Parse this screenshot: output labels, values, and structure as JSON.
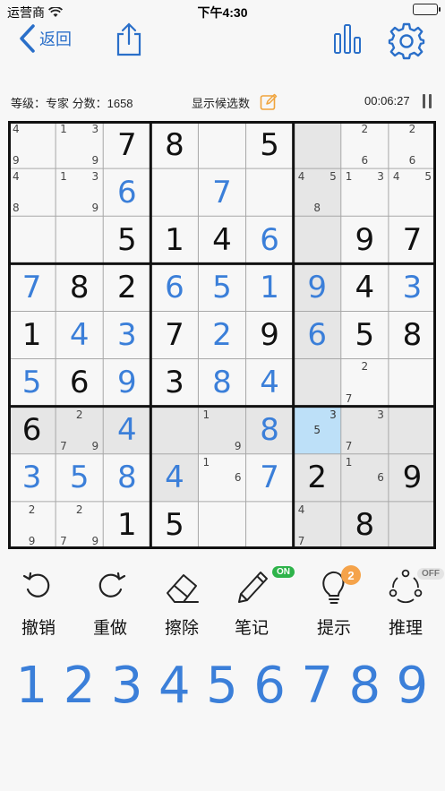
{
  "status_bar": {
    "carrier": "运营商",
    "time": "下午4:30"
  },
  "nav": {
    "back_label": "返回"
  },
  "info": {
    "level_score": "等级：专家 分数：1658",
    "show_candidates": "显示候选数",
    "timer": "00:06:27"
  },
  "colors": {
    "accent": "#3b7fd9",
    "given": "#111111",
    "shaded": "#e6e6e6",
    "selected": "#bde0f8",
    "on": "#2eb34a",
    "badge": "#f5a34a"
  },
  "board": {
    "rows": [
      [
        {
          "n": "4.....9"
        },
        {
          "n": "1.3.....9"
        },
        {
          "v": "7",
          "t": "g"
        },
        {
          "v": "8",
          "t": "g"
        },
        {},
        {
          "v": "5",
          "t": "g"
        },
        {
          "s": 1
        },
        {
          "n": ".2.....6."
        },
        {
          "n": ".2.....6"
        }
      ],
      [
        {
          "n": "4.....8"
        },
        {
          "n": "1.3.....9"
        },
        {
          "v": "6",
          "t": "u"
        },
        {},
        {
          "v": "7",
          "t": "u"
        },
        {},
        {
          "s": 1,
          "n": "4.5....8"
        },
        {
          "n": "1.3"
        },
        {
          "n": "4.5"
        }
      ],
      [
        {},
        {},
        {
          "v": "5",
          "t": "g"
        },
        {
          "v": "1",
          "t": "g"
        },
        {
          "v": "4",
          "t": "g"
        },
        {
          "v": "6",
          "t": "u"
        },
        {
          "s": 1
        },
        {
          "v": "9",
          "t": "g"
        },
        {
          "v": "7",
          "t": "g"
        }
      ],
      [
        {
          "v": "7",
          "t": "u"
        },
        {
          "v": "8",
          "t": "g"
        },
        {
          "v": "2",
          "t": "g"
        },
        {
          "v": "6",
          "t": "u"
        },
        {
          "v": "5",
          "t": "u"
        },
        {
          "v": "1",
          "t": "u"
        },
        {
          "v": "9",
          "t": "u",
          "s": 1
        },
        {
          "v": "4",
          "t": "g"
        },
        {
          "v": "3",
          "t": "u"
        }
      ],
      [
        {
          "v": "1",
          "t": "g"
        },
        {
          "v": "4",
          "t": "u"
        },
        {
          "v": "3",
          "t": "u"
        },
        {
          "v": "7",
          "t": "g"
        },
        {
          "v": "2",
          "t": "u"
        },
        {
          "v": "9",
          "t": "g"
        },
        {
          "v": "6",
          "t": "u",
          "s": 1
        },
        {
          "v": "5",
          "t": "g"
        },
        {
          "v": "8",
          "t": "g"
        }
      ],
      [
        {
          "v": "5",
          "t": "u"
        },
        {
          "v": "6",
          "t": "g"
        },
        {
          "v": "9",
          "t": "u"
        },
        {
          "v": "3",
          "t": "g"
        },
        {
          "v": "8",
          "t": "u"
        },
        {
          "v": "4",
          "t": "u"
        },
        {
          "s": 1
        },
        {
          "n": ".2....7"
        },
        {}
      ],
      [
        {
          "v": "6",
          "t": "g",
          "s": 1
        },
        {
          "s": 1,
          "n": ".2....7.9"
        },
        {
          "v": "4",
          "t": "u",
          "s": 1
        },
        {
          "s": 1
        },
        {
          "s": 1,
          "n": "1.......9"
        },
        {
          "v": "8",
          "t": "u",
          "s": 1
        },
        {
          "sel": 1,
          "n": "..3.5"
        },
        {
          "s": 1,
          "n": "..3...7"
        },
        {
          "s": 1
        }
      ],
      [
        {
          "v": "3",
          "t": "u"
        },
        {
          "v": "5",
          "t": "u"
        },
        {
          "v": "8",
          "t": "u"
        },
        {
          "v": "4",
          "t": "u",
          "s": 1
        },
        {
          "n": "1....6"
        },
        {
          "v": "7",
          "t": "u"
        },
        {
          "v": "2",
          "t": "g",
          "s": 1
        },
        {
          "s": 1,
          "n": "1....6"
        },
        {
          "v": "9",
          "t": "g",
          "s": 1
        }
      ],
      [
        {
          "n": ".2.....9"
        },
        {
          "n": ".2....7.9"
        },
        {
          "v": "1",
          "t": "g"
        },
        {
          "v": "5",
          "t": "g"
        },
        {},
        {},
        {
          "s": 1,
          "n": "4.....7"
        },
        {
          "v": "8",
          "t": "g",
          "s": 1
        },
        {
          "s": 1
        }
      ]
    ]
  },
  "tools": [
    {
      "id": "undo",
      "label": "撤销"
    },
    {
      "id": "redo",
      "label": "重做"
    },
    {
      "id": "erase",
      "label": "擦除"
    },
    {
      "id": "note",
      "label": "笔记",
      "pill": "ON"
    },
    {
      "id": "hint",
      "label": "提示",
      "badge": "2"
    },
    {
      "id": "reason",
      "label": "推理",
      "pill": "OFF"
    }
  ],
  "numpad": [
    "1",
    "2",
    "3",
    "4",
    "5",
    "6",
    "7",
    "8",
    "9"
  ]
}
